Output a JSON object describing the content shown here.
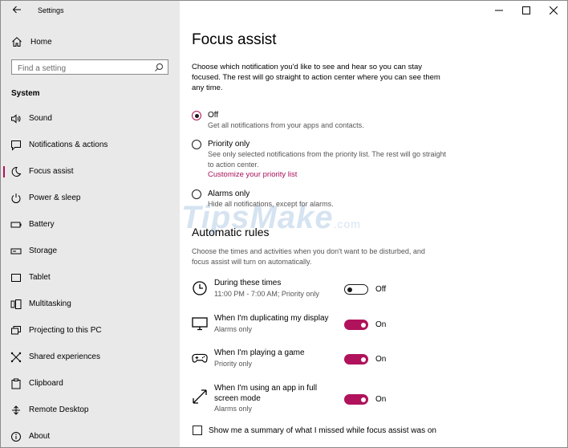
{
  "window": {
    "title": "Settings"
  },
  "sidebar": {
    "home_label": "Home",
    "search_placeholder": "Find a setting",
    "section": "System",
    "items": [
      {
        "label": "Sound",
        "icon": "speaker-icon"
      },
      {
        "label": "Notifications & actions",
        "icon": "notification-icon"
      },
      {
        "label": "Focus assist",
        "icon": "moon-icon",
        "active": true
      },
      {
        "label": "Power & sleep",
        "icon": "power-icon"
      },
      {
        "label": "Battery",
        "icon": "battery-icon"
      },
      {
        "label": "Storage",
        "icon": "storage-icon"
      },
      {
        "label": "Tablet",
        "icon": "tablet-icon"
      },
      {
        "label": "Multitasking",
        "icon": "multitasking-icon"
      },
      {
        "label": "Projecting to this PC",
        "icon": "projecting-icon"
      },
      {
        "label": "Shared experiences",
        "icon": "shared-icon"
      },
      {
        "label": "Clipboard",
        "icon": "clipboard-icon"
      },
      {
        "label": "Remote Desktop",
        "icon": "remote-desktop-icon"
      },
      {
        "label": "About",
        "icon": "info-icon"
      }
    ]
  },
  "main": {
    "title": "Focus assist",
    "description": "Choose which notification you'd like to see and hear so you can stay focused. The rest will go straight to action center where you can see them any time.",
    "options": [
      {
        "label": "Off",
        "description": "Get all notifications from your apps and contacts.",
        "checked": true
      },
      {
        "label": "Priority only",
        "description": "See only selected notifications from the priority list. The rest will go straight to action center.",
        "link": "Customize your priority list"
      },
      {
        "label": "Alarms only",
        "description": "Hide all notifications, except for alarms."
      }
    ],
    "automatic_rules": {
      "title": "Automatic rules",
      "description": "Choose the times and activities when you don't want to be disturbed, and focus assist will turn on automatically.",
      "rules": [
        {
          "title": "During these times",
          "detail": "11:00 PM - 7:00 AM; Priority only",
          "state": "Off",
          "icon": "clock-icon"
        },
        {
          "title": "When I'm duplicating my display",
          "detail": "Alarms only",
          "state": "On",
          "icon": "monitor-icon"
        },
        {
          "title": "When I'm playing a game",
          "detail": "Priority only",
          "state": "On",
          "icon": "gamepad-icon"
        },
        {
          "title": "When I'm using an app in full screen mode",
          "detail": "Alarms only",
          "state": "On",
          "icon": "fullscreen-icon"
        }
      ]
    },
    "summary_checkbox": "Show me a summary of what I missed while focus assist was on"
  },
  "watermark": {
    "text": "TipsMake",
    "suffix": ".com"
  },
  "colors": {
    "accent": "#b0125b",
    "sidebar_bg": "#e9e9e9"
  }
}
